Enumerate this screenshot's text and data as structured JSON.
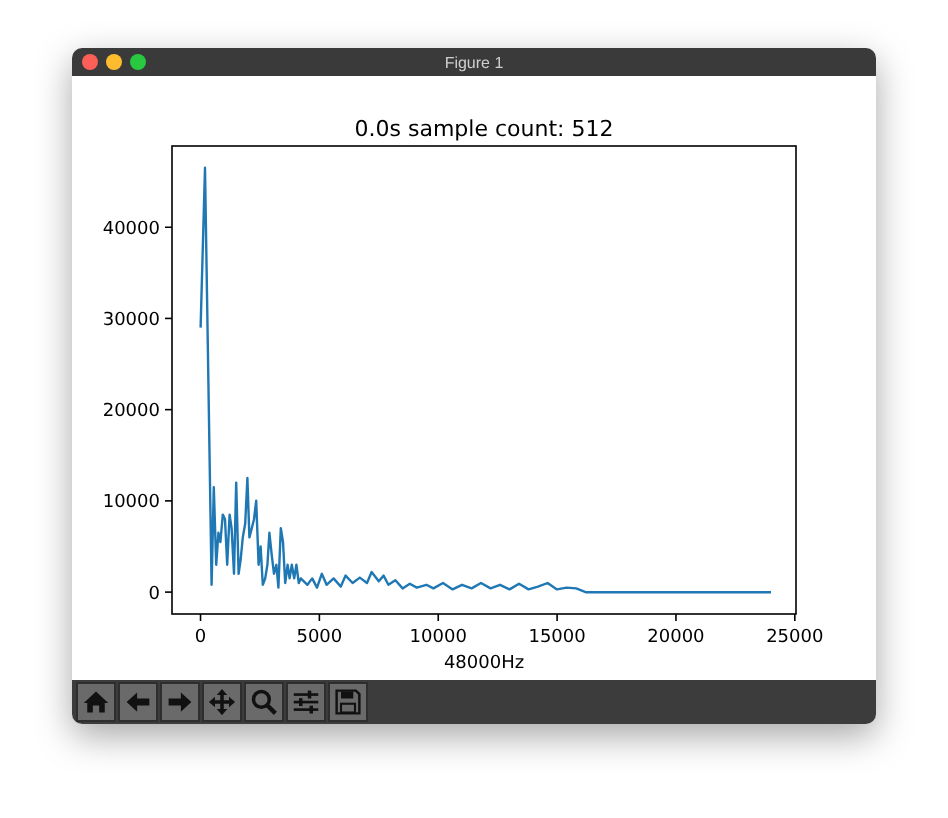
{
  "window": {
    "title": "Figure 1"
  },
  "figure": {
    "chart_data": {
      "type": "line",
      "title": "0.0s sample count: 512",
      "xlabel": "48000Hz",
      "xlim": [
        -1200,
        25050
      ],
      "ylim": [
        -2400,
        48900
      ],
      "xticks": [
        0,
        5000,
        10000,
        15000,
        20000,
        25000
      ],
      "yticks": [
        0,
        10000,
        20000,
        30000,
        40000
      ],
      "x": [
        0,
        190,
        470,
        560,
        660,
        750,
        840,
        940,
        1030,
        1120,
        1220,
        1310,
        1410,
        1500,
        1600,
        1690,
        1780,
        1880,
        1970,
        2060,
        2160,
        2250,
        2340,
        2440,
        2530,
        2620,
        2720,
        2810,
        2900,
        3000,
        3090,
        3190,
        3280,
        3380,
        3470,
        3560,
        3660,
        3750,
        3840,
        3940,
        4030,
        4130,
        4220,
        4500,
        4700,
        4900,
        5100,
        5300,
        5600,
        5900,
        6100,
        6400,
        6700,
        7000,
        7200,
        7500,
        7700,
        7900,
        8200,
        8500,
        8800,
        9100,
        9500,
        9800,
        10200,
        10600,
        11000,
        11400,
        11800,
        12200,
        12600,
        13000,
        13400,
        13800,
        14200,
        14600,
        15000,
        15400,
        15800,
        16200,
        17000,
        18000,
        20000,
        22000,
        24000
      ],
      "series": [
        {
          "color": "#1f77b4",
          "values": [
            29000,
            46500,
            800,
            11500,
            3000,
            6500,
            5500,
            8500,
            8000,
            3000,
            8500,
            7000,
            2000,
            12000,
            2000,
            3500,
            6000,
            7500,
            12500,
            6000,
            7000,
            8000,
            10000,
            3000,
            5000,
            800,
            1500,
            3000,
            6500,
            4000,
            2000,
            3000,
            500,
            7000,
            5500,
            1000,
            3000,
            1500,
            3000,
            1500,
            3000,
            1000,
            1500,
            800,
            1500,
            500,
            2000,
            800,
            1500,
            600,
            1800,
            1000,
            1600,
            1000,
            2200,
            1200,
            1800,
            800,
            1300,
            400,
            900,
            500,
            800,
            400,
            1000,
            300,
            800,
            400,
            1000,
            400,
            800,
            300,
            900,
            300,
            600,
            1000,
            300,
            500,
            400,
            0,
            0,
            0,
            0,
            0,
            0
          ]
        }
      ]
    }
  },
  "toolbar": {
    "buttons": [
      {
        "kind": "home"
      },
      {
        "kind": "back"
      },
      {
        "kind": "forward"
      },
      {
        "kind": "pan"
      },
      {
        "kind": "zoom"
      },
      {
        "kind": "configure"
      },
      {
        "kind": "save"
      }
    ]
  }
}
